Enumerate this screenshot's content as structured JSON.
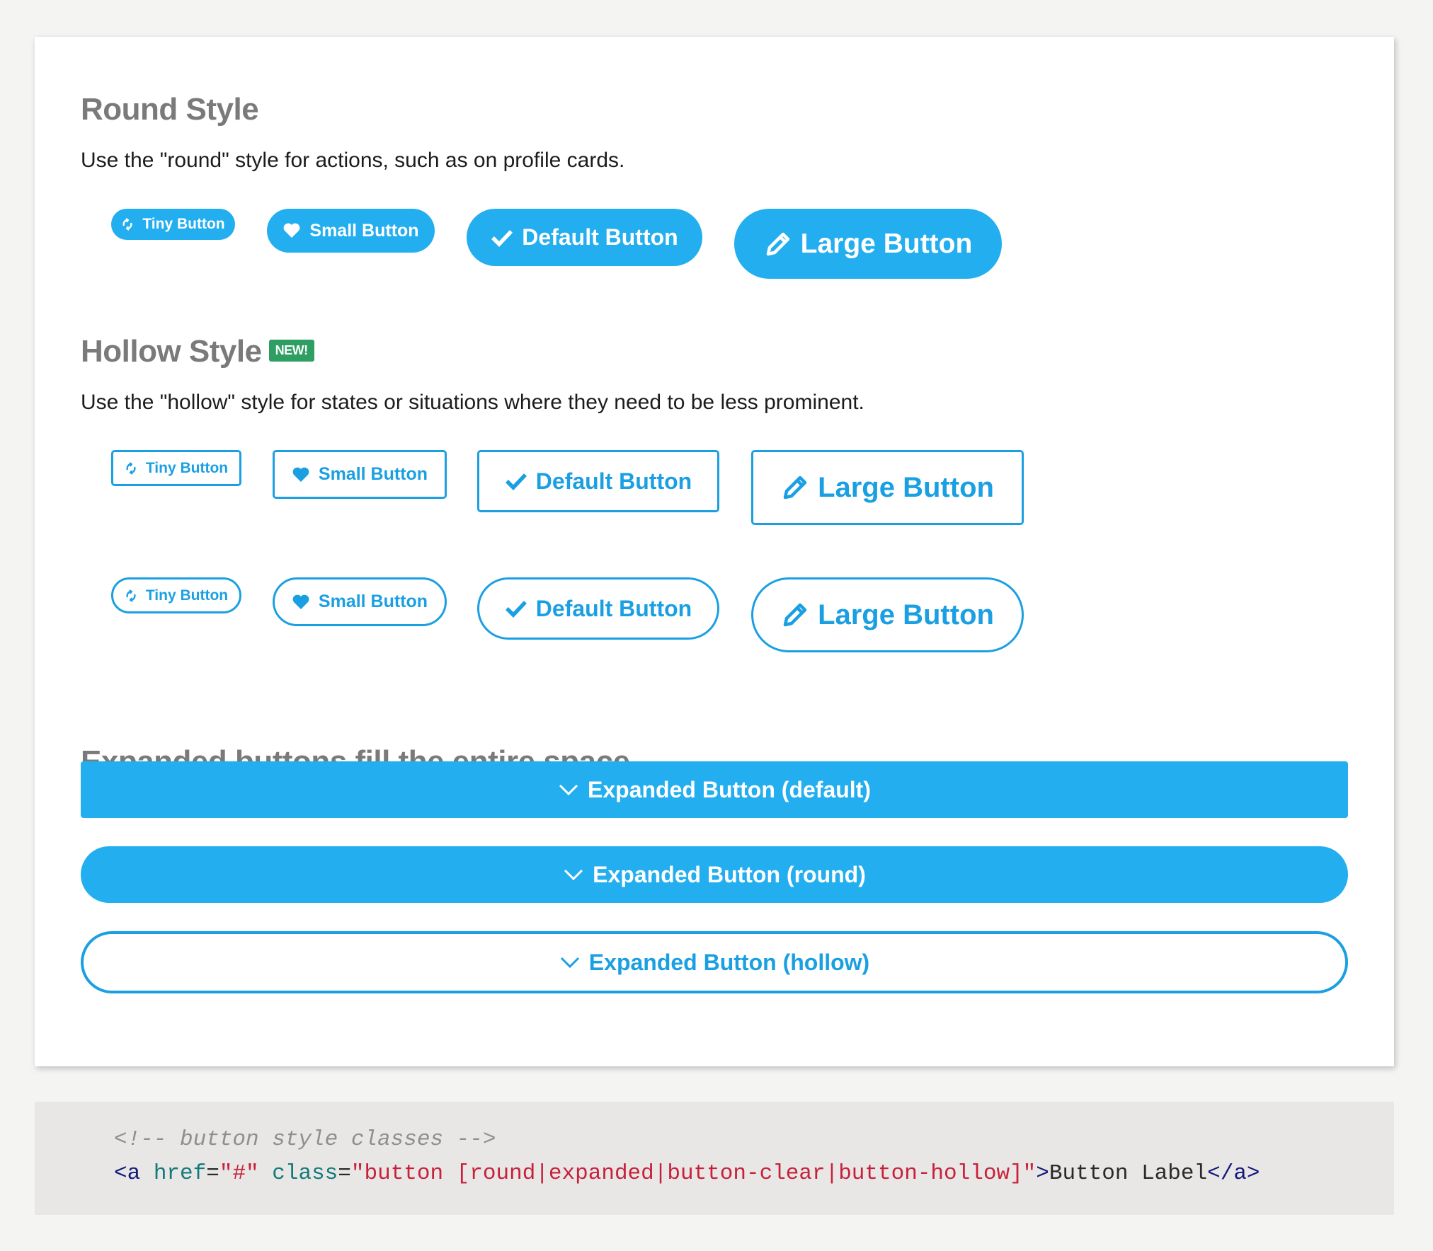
{
  "round_section": {
    "title": "Round Style",
    "description": "Use the \"round\" style for actions, such as on profile cards.",
    "buttons": [
      {
        "label": "Tiny Button",
        "icon": "refresh-icon"
      },
      {
        "label": "Small Button",
        "icon": "heart-icon"
      },
      {
        "label": "Default Button",
        "icon": "check-icon"
      },
      {
        "label": "Large Button",
        "icon": "pencil-icon"
      }
    ]
  },
  "hollow_section": {
    "title": "Hollow Style",
    "badge": "NEW!",
    "description": "Use the \"hollow\" style for states or situations where they need to be less prominent.",
    "square_buttons": [
      {
        "label": "Tiny Button",
        "icon": "refresh-icon"
      },
      {
        "label": "Small Button",
        "icon": "heart-icon"
      },
      {
        "label": "Default Button",
        "icon": "check-icon"
      },
      {
        "label": "Large Button",
        "icon": "pencil-icon"
      }
    ],
    "round_buttons": [
      {
        "label": "Tiny Button",
        "icon": "refresh-icon"
      },
      {
        "label": "Small Button",
        "icon": "heart-icon"
      },
      {
        "label": "Default Button",
        "icon": "check-icon"
      },
      {
        "label": "Large Button",
        "icon": "pencil-icon"
      }
    ]
  },
  "expanded_section": {
    "title": "Expanded buttons fill the entire space.",
    "buttons": [
      {
        "label": "Expanded Button (default)",
        "icon": "chevron-down-icon"
      },
      {
        "label": "Expanded Button (round)",
        "icon": "chevron-down-icon"
      },
      {
        "label": "Expanded Button (hollow)",
        "icon": "chevron-down-icon"
      }
    ]
  },
  "code": {
    "comment": "<!-- button style classes -->",
    "open_tag": "<a",
    "href_attr": " href",
    "eq1": "=",
    "href_val": "\"#\"",
    "class_attr": " class",
    "eq2": "=",
    "class_val": "\"button [round|expanded|button-clear|button-hollow]\"",
    "gt": ">",
    "inner_text": "Button Label",
    "close_tag": "</a>"
  },
  "colors": {
    "primary": "#23aef0",
    "hollow_border": "#1aa0e2",
    "badge": "#2e9e63",
    "heading": "#7a7a7a"
  }
}
